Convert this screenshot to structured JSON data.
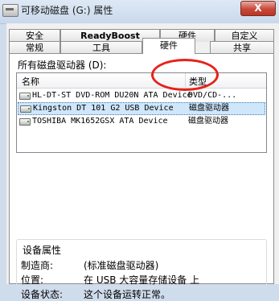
{
  "window": {
    "title": "可移动磁盘 (G:) 属性",
    "close_label": "X"
  },
  "tabs": {
    "row1": [
      "安全",
      "ReadyBoost",
      "硬件",
      "自定义"
    ],
    "row2": [
      "常规",
      "工具",
      "硬件",
      "共享"
    ],
    "active": "硬件"
  },
  "hardware": {
    "drives_label": "所有磁盘驱动器 (D):",
    "columns": {
      "name": "名称",
      "type": "类型"
    },
    "rows": [
      {
        "name": "HL-DT-ST DVD-ROM DU20N ATA Device",
        "type": "DVD/CD-..."
      },
      {
        "name": "Kingston DT 101 G2 USB Device",
        "type": "磁盘驱动器"
      },
      {
        "name": "TOSHIBA MK1652GSX ATA Device",
        "type": "磁盘驱动器"
      }
    ],
    "selected_row": 1
  },
  "device_properties": {
    "legend": "设备属性",
    "manufacturer_label": "制造商:",
    "manufacturer_value": "(标准磁盘驱动器)",
    "location_label": "位置:",
    "location_value": "在 USB 大容量存储设备 上",
    "status_label": "设备状态:",
    "status_value": "这个设备运转正常。"
  },
  "colors": {
    "annotation": "#e6221b",
    "selection": "#cfe6fb"
  }
}
